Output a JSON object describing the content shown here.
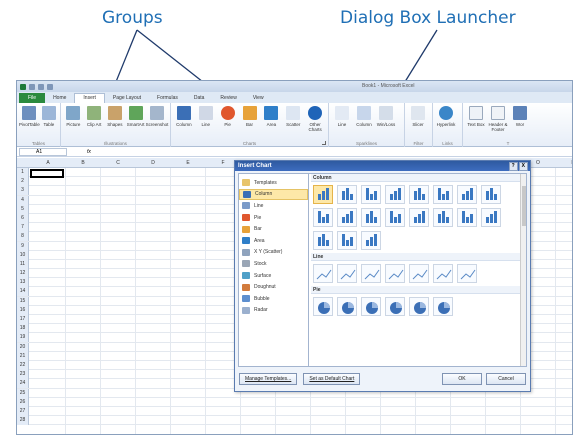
{
  "callouts": {
    "groups": "Groups",
    "launcher": "Dialog Box Launcher"
  },
  "window": {
    "title": "Book1 - Microsoft Excel"
  },
  "tabs": [
    "File",
    "Home",
    "Insert",
    "Page Layout",
    "Formulas",
    "Data",
    "Review",
    "View"
  ],
  "ribbon": {
    "groups": [
      {
        "label": "Tables",
        "buttons": [
          "PivotTable",
          "Table"
        ]
      },
      {
        "label": "Illustrations",
        "buttons": [
          "Picture",
          "Clip Art",
          "Shapes",
          "SmartArt",
          "Screenshot"
        ]
      },
      {
        "label": "Charts",
        "buttons": [
          "Column",
          "Line",
          "Pie",
          "Bar",
          "Area",
          "Scatter",
          "Other Charts"
        ]
      },
      {
        "label": "Sparklines",
        "buttons": [
          "Line",
          "Column",
          "Win/Loss"
        ]
      },
      {
        "label": "Filter",
        "buttons": [
          "Slicer"
        ]
      },
      {
        "label": "Links",
        "buttons": [
          "Hyperlink"
        ]
      },
      {
        "label": "T",
        "buttons": [
          "Text Box",
          "Header & Footer",
          "Wor"
        ]
      }
    ]
  },
  "formula_bar": {
    "name_box": "A1",
    "fx": "fx"
  },
  "columns": [
    "A",
    "B",
    "C",
    "D",
    "E",
    "F",
    "G",
    "H",
    "I",
    "J",
    "K",
    "L",
    "M",
    "N",
    "O",
    "P"
  ],
  "rows": [
    "1",
    "2",
    "3",
    "4",
    "5",
    "6",
    "7",
    "8",
    "9",
    "10",
    "11",
    "12",
    "13",
    "14",
    "15",
    "16",
    "17",
    "18",
    "19",
    "20",
    "21",
    "22",
    "23",
    "24",
    "25",
    "26",
    "27",
    "28"
  ],
  "dialog": {
    "title": "Insert Chart",
    "controls": [
      "?",
      "X"
    ],
    "chart_types": [
      "Templates",
      "Column",
      "Line",
      "Pie",
      "Bar",
      "Area",
      "X Y (Scatter)",
      "Stock",
      "Surface",
      "Doughnut",
      "Bubble",
      "Radar"
    ],
    "selected_type": "Column",
    "sections": [
      "Column",
      "Line",
      "Pie"
    ],
    "manage_templates": "Manage Templates...",
    "set_default": "Set as Default Chart",
    "ok": "OK",
    "cancel": "Cancel"
  },
  "colors": {
    "accent": "#1f6fb5",
    "file_tab": "#2b8a3e",
    "dialog_title": "#2e5aa0",
    "selection": "#fde8a8"
  }
}
